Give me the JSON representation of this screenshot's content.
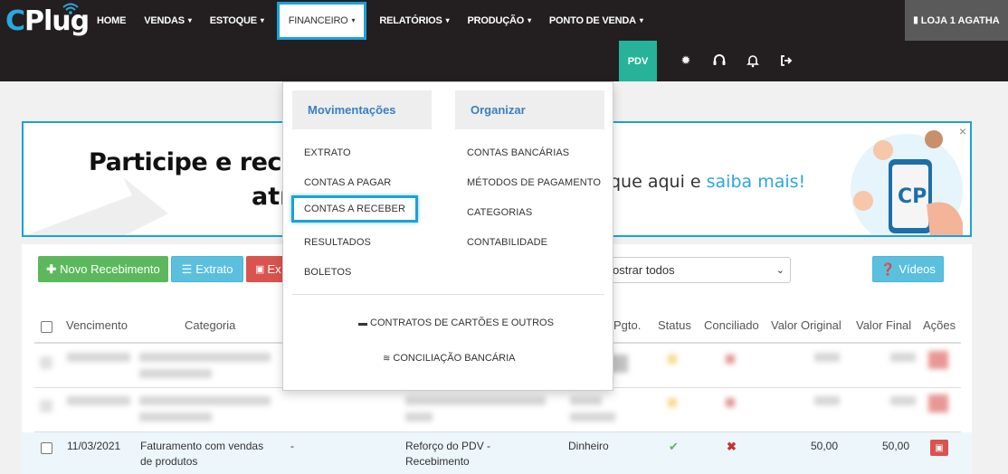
{
  "brand": {
    "logo_text_c": "C",
    "logo_text_rest": "Plug"
  },
  "nav": {
    "items": [
      {
        "label": "HOME",
        "caret": ""
      },
      {
        "label": "VENDAS",
        "caret": "▾"
      },
      {
        "label": "ESTOQUE",
        "caret": "▾"
      },
      {
        "label": "FINANCEIRO",
        "caret": "▾"
      },
      {
        "label": "RELATÓRIOS",
        "caret": "▾"
      },
      {
        "label": "PRODUÇÃO",
        "caret": "▾"
      },
      {
        "label": "PONTO DE VENDA",
        "caret": "▾"
      }
    ],
    "store_label": "LOJA 1 AGATHA"
  },
  "subbar": {
    "pdv_label": "PDV",
    "icons": [
      "gear-icon",
      "headset-icon",
      "bell-icon",
      "sign-out-icon"
    ]
  },
  "banner": {
    "line1": "Participe e rece",
    "line2": "atr",
    "right_text": "que aqui e ",
    "right_link": "saiba mais",
    "right_end": "!",
    "close": "×"
  },
  "toolbar": {
    "new_label": "Novo Recebimento",
    "extrato_label": "Extrato",
    "export_label": "Ex",
    "filter_value": "ostrar todos",
    "videos_label": "Vídeos"
  },
  "table": {
    "headers": {
      "vencimento": "Vencimento",
      "categoria": "Categoria",
      "pgto": "Pgto.",
      "status": "Status",
      "conciliado": "Conciliado",
      "valor_original": "Valor Original",
      "valor_final": "Valor Final",
      "acoes": "Ações"
    },
    "row": {
      "vencimento": "11/03/2021",
      "categoria_l1": "Faturamento com vendas",
      "categoria_l2": "de produtos",
      "col3": "-",
      "desc_l1": "Reforço do PDV -",
      "desc_l2": "Recebimento",
      "pgto": "Dinheiro",
      "valor_original": "50,00",
      "valor_final": "50,00"
    }
  },
  "menu": {
    "col1_title": "Movimentações",
    "col2_title": "Organizar",
    "col1": [
      "EXTRATO",
      "CONTAS A PAGAR",
      "CONTAS A RECEBER",
      "RESULTADOS",
      "BOLETOS"
    ],
    "col2": [
      "CONTAS BANCÁRIAS",
      "MÉTODOS DE PAGAMENTO",
      "CATEGORIAS",
      "CONTABILIDADE"
    ],
    "footer1": "CONTRATOS DE CARTÕES E OUTROS",
    "footer2": "CONCILIAÇÃO BANCÁRIA"
  },
  "colors": {
    "accent": "#1da1d9",
    "success": "#5cb85c",
    "info": "#5bc0de",
    "danger": "#d9534f",
    "dark": "#231f20",
    "pdv": "#26b39a"
  }
}
